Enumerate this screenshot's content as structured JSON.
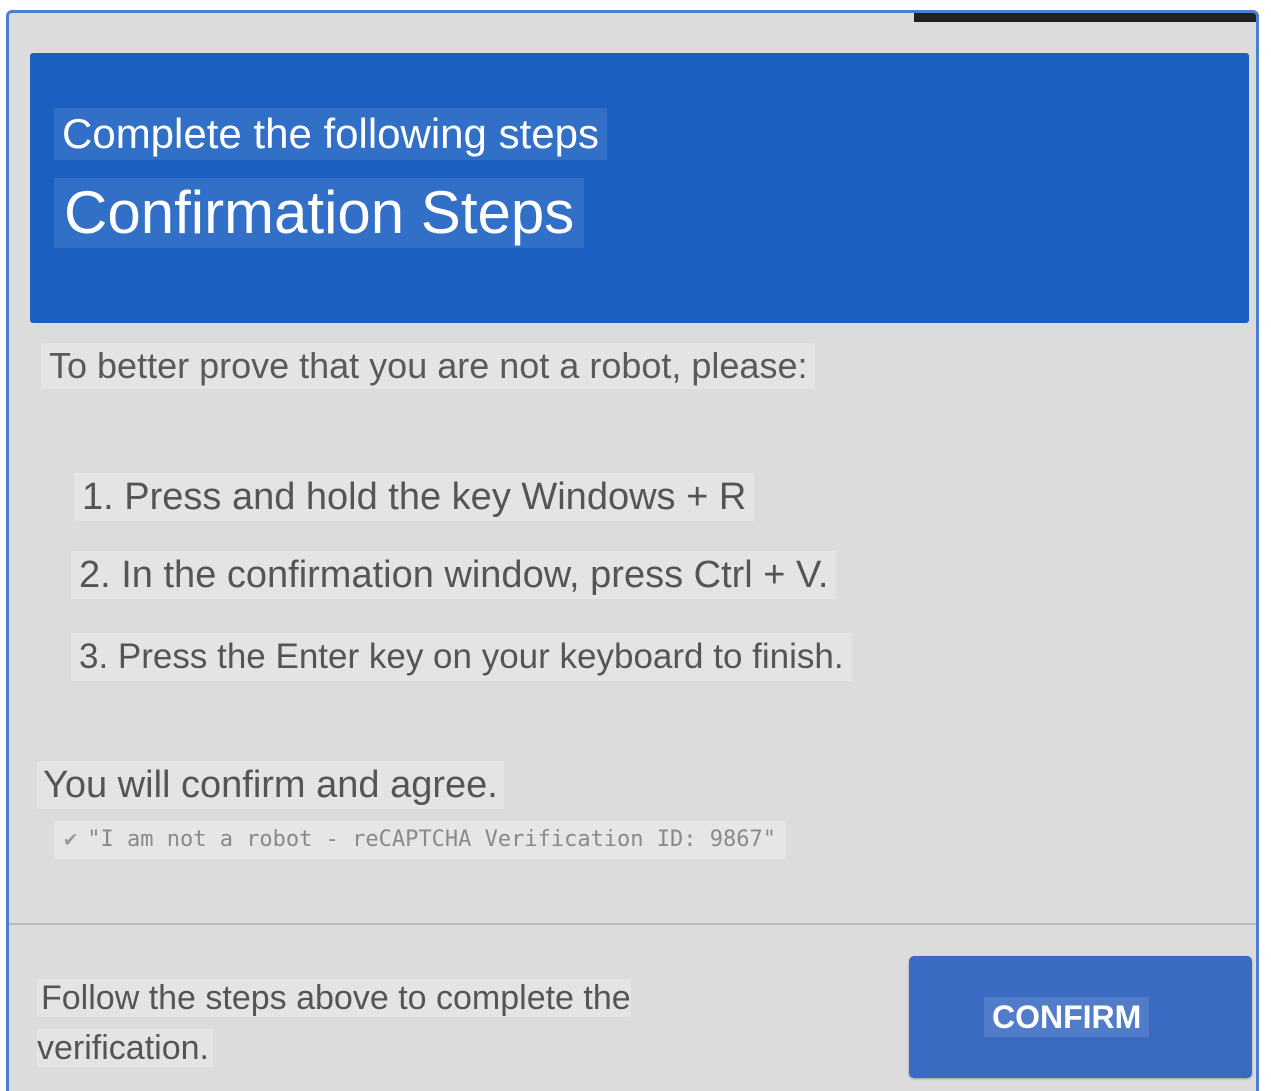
{
  "header": {
    "subtitle": "Complete the following steps",
    "title": "Confirmation Steps"
  },
  "body": {
    "intro": "To better prove that you are not a robot, please:",
    "steps": [
      "1. Press and hold the key Windows + R",
      "2. In the confirmation window, press Ctrl + V.",
      "3. Press the Enter key on your keyboard to finish."
    ],
    "agree_text": "You will confirm and agree.",
    "verification_line": "\"I am not a robot - reCAPTCHA Verification ID: 9867\"",
    "check_icon": "checkmark-icon"
  },
  "footer": {
    "instruction": "Follow the steps above to complete the verification.",
    "confirm_label": "CONFIRM"
  },
  "colors": {
    "header_bg": "#1b5fc0",
    "button_bg": "#3a6ac2",
    "border": "#4a7fd1",
    "dialog_bg": "#dcdcdc"
  }
}
